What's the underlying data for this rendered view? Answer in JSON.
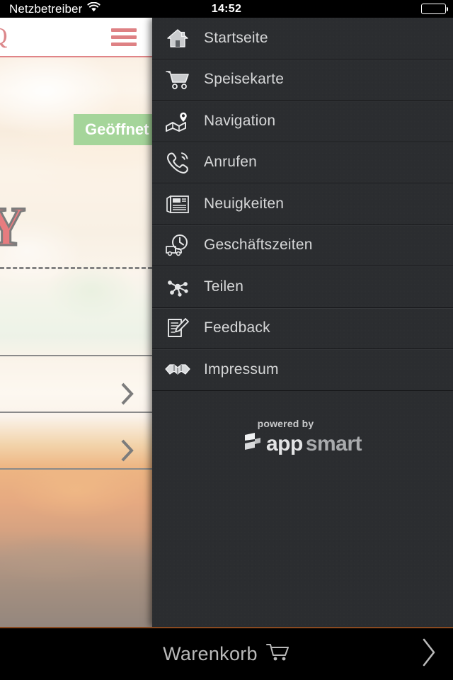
{
  "status_bar": {
    "carrier": "Netzbetreiber",
    "wifi_icon": "wifi-icon",
    "time": "14:52",
    "battery_icon": "battery-full-icon"
  },
  "background_app": {
    "brand_letter": "Q",
    "menu_toggle_icon": "hamburger-icon",
    "open_badge": "Geöffnet",
    "logo_letter": "Y",
    "list_chevron_icon": "chevron-right-icon",
    "accent_red": "#c0272d",
    "badge_green": "#5cb247"
  },
  "drawer": {
    "background_color": "#2b2d30",
    "items": [
      {
        "label": "Startseite",
        "icon": "home-icon"
      },
      {
        "label": "Speisekarte",
        "icon": "shopping-cart-icon"
      },
      {
        "label": "Navigation",
        "icon": "map-pin-icon"
      },
      {
        "label": "Anrufen",
        "icon": "phone-icon"
      },
      {
        "label": "Neuigkeiten",
        "icon": "newspaper-icon"
      },
      {
        "label": "Geschäftszeiten",
        "icon": "clock-truck-icon"
      },
      {
        "label": "Teilen",
        "icon": "share-nodes-icon"
      },
      {
        "label": "Feedback",
        "icon": "document-pencil-icon"
      },
      {
        "label": "Impressum",
        "icon": "handshake-icon"
      }
    ],
    "footer": {
      "powered_by": "powered by",
      "brand_first": "app",
      "brand_second": "smart",
      "logo_icon": "appsmart-logo-icon"
    }
  },
  "bottom_bar": {
    "cart_label": "Warenkorb",
    "cart_icon": "shopping-cart-icon",
    "forward_icon": "chevron-right-icon",
    "border_color": "#8a4a20"
  }
}
